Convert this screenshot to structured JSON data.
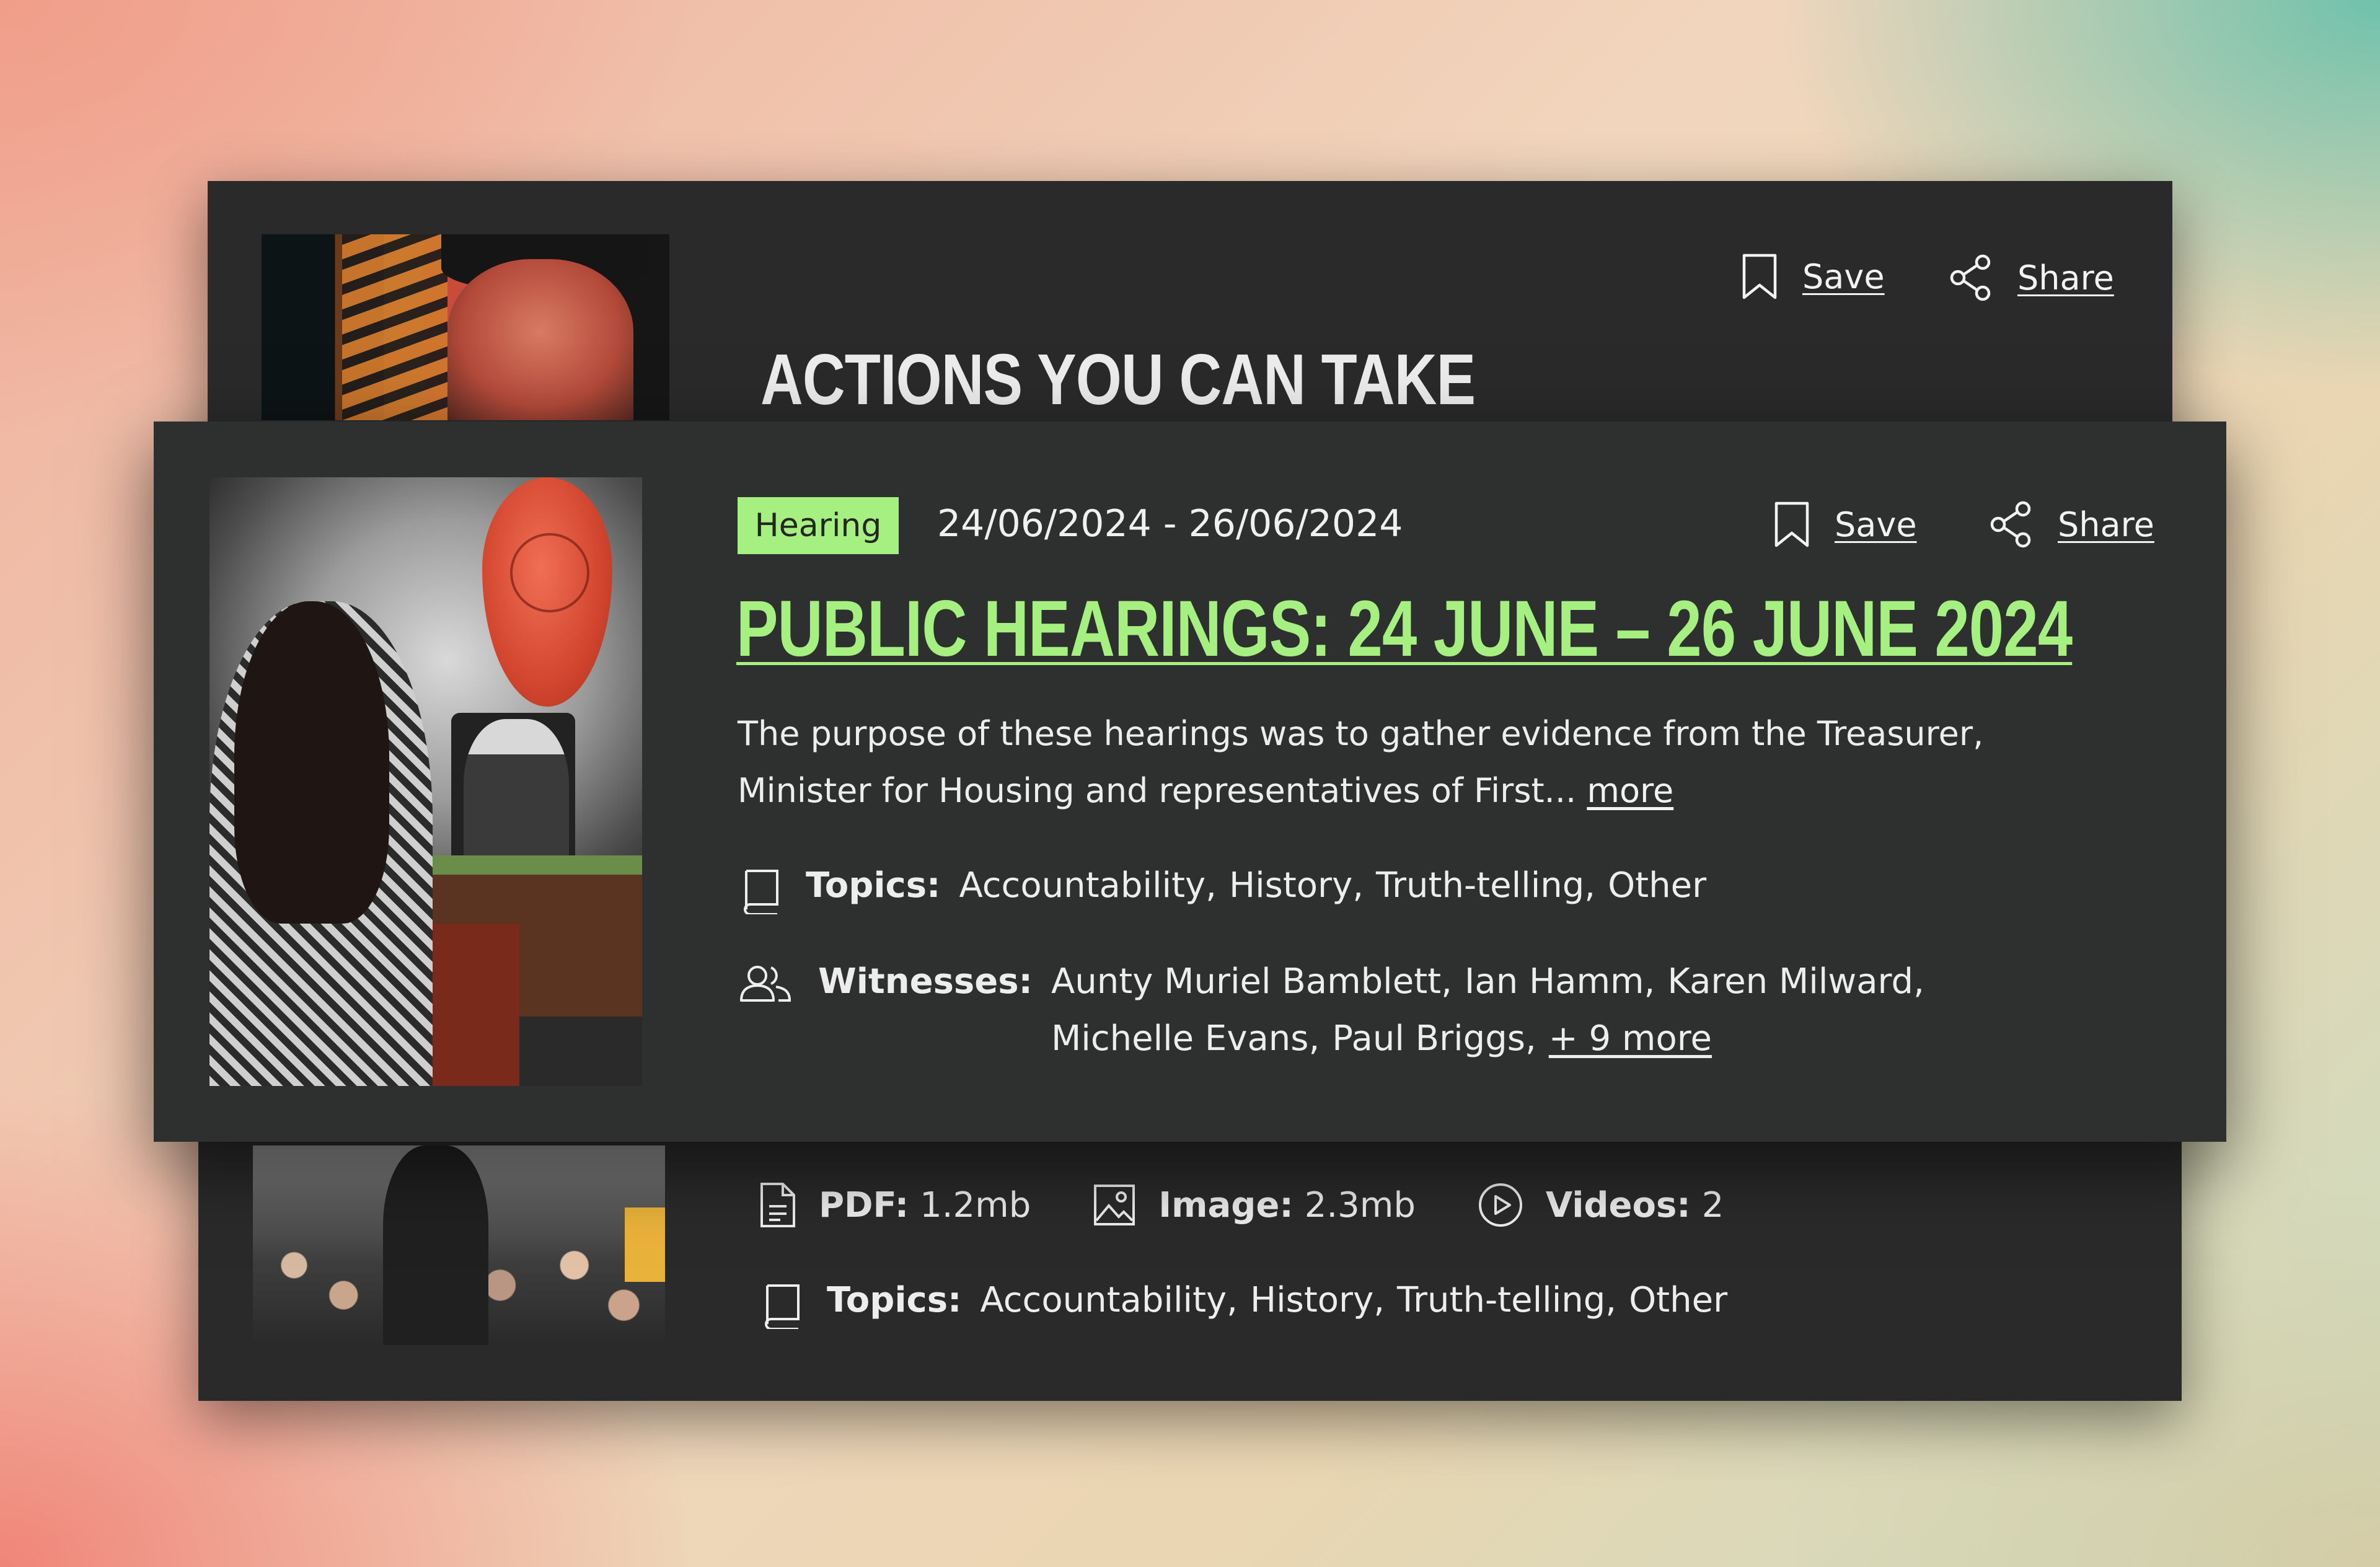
{
  "back_card_top": {
    "heading": "ACTIONS YOU CAN TAKE",
    "save_label": "Save",
    "share_label": "Share"
  },
  "featured": {
    "badge": "Hearing",
    "dates": "24/06/2024 - 26/06/2024",
    "save_label": "Save",
    "share_label": "Share",
    "title": "PUBLIC HEARINGS: 24 JUNE – 26 JUNE 2024",
    "description": "The purpose of these hearings was to gather evidence from the Treasurer, Minister for Housing and representatives of First...",
    "more_label": "more",
    "topics_label": "Topics:",
    "topics": [
      "Accountability,",
      "History,",
      "Truth-telling,",
      "Other"
    ],
    "witnesses_label": "Witnesses:",
    "witnesses": [
      "Aunty Muriel Bamblett,",
      "Ian Hamm,",
      "Karen Milward,",
      "Michelle Evans,",
      "Paul Briggs,"
    ],
    "witnesses_more": "+ 9 more"
  },
  "back_card_bottom": {
    "pdf_label": "PDF:",
    "pdf_size": "1.2mb",
    "image_label": "Image:",
    "image_size": "2.3mb",
    "videos_label": "Videos:",
    "videos_count": "2",
    "topics_label": "Topics:",
    "topics": [
      "Accountability,",
      "History,",
      "Truth-telling,",
      "Other"
    ]
  },
  "colors": {
    "accent_green": "#a6f082",
    "card_dark": "#2a2a2a",
    "card_front": "#2d302e"
  },
  "icons": [
    "bookmark-icon",
    "share-icon",
    "book-icon",
    "people-icon",
    "pdf-file-icon",
    "image-icon",
    "play-icon"
  ]
}
